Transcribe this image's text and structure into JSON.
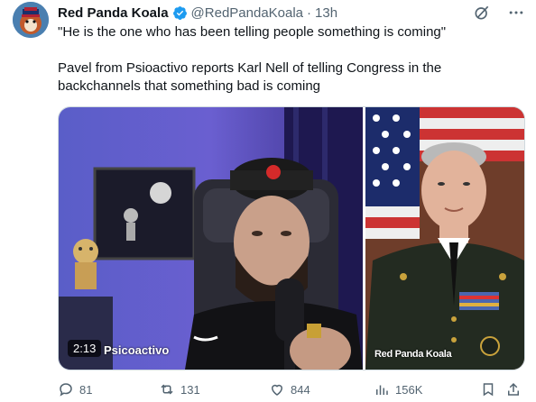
{
  "post": {
    "author_name": "Red Panda Koala",
    "handle": "@RedPandaKoala",
    "separator": "·",
    "time": "13h",
    "text": "\"He is the one who has been telling people something is coming\"\n\nPavel from Psioactivo reports Karl Nell of telling Congress in the backchannels that something bad is coming"
  },
  "media": {
    "video_duration": "2:13",
    "video_watermark": "Psicoactivo",
    "photo_watermark": "Red Panda Koala"
  },
  "actions": {
    "replies": "81",
    "reposts": "131",
    "likes": "844",
    "views": "156K"
  },
  "colors": {
    "verified": "#1d9bf0",
    "muted": "#536471"
  }
}
